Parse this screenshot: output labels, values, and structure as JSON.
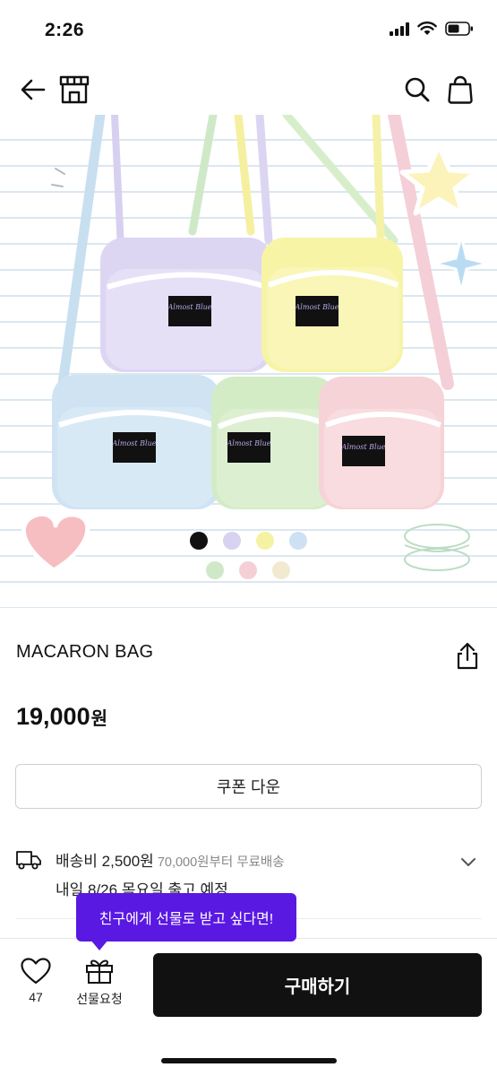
{
  "status_bar": {
    "time": "2:26"
  },
  "product": {
    "image_label": "Almost Blue",
    "name": "MACARON BAG",
    "price": "19,000",
    "currency": "원"
  },
  "coupon": {
    "label": "쿠폰 다운"
  },
  "shipping": {
    "fee": "배송비 2,500원",
    "free_threshold": "70,000원부터 무료배송",
    "date": "내일 8/26 목요일 출고 예정"
  },
  "tooltip": {
    "text": "친구에게 선물로 받고 싶다면!"
  },
  "bottom_bar": {
    "like_count": "47",
    "gift_label": "선물요청",
    "buy_label": "구매하기"
  },
  "colors": {
    "accent_purple": "#5a18e3",
    "bag_lavender": "#ddd6f3",
    "bag_yellow": "#f7f4a6",
    "bag_blue": "#cfe3f3",
    "bag_green": "#d3ecc6",
    "bag_pink": "#f6d3d6"
  },
  "color_swatches": [
    "#111111",
    "#d8d2f1",
    "#f6f2a3",
    "#cde1f3",
    "#cfe9c8",
    "#f4cfd6",
    "#f2ead0"
  ]
}
